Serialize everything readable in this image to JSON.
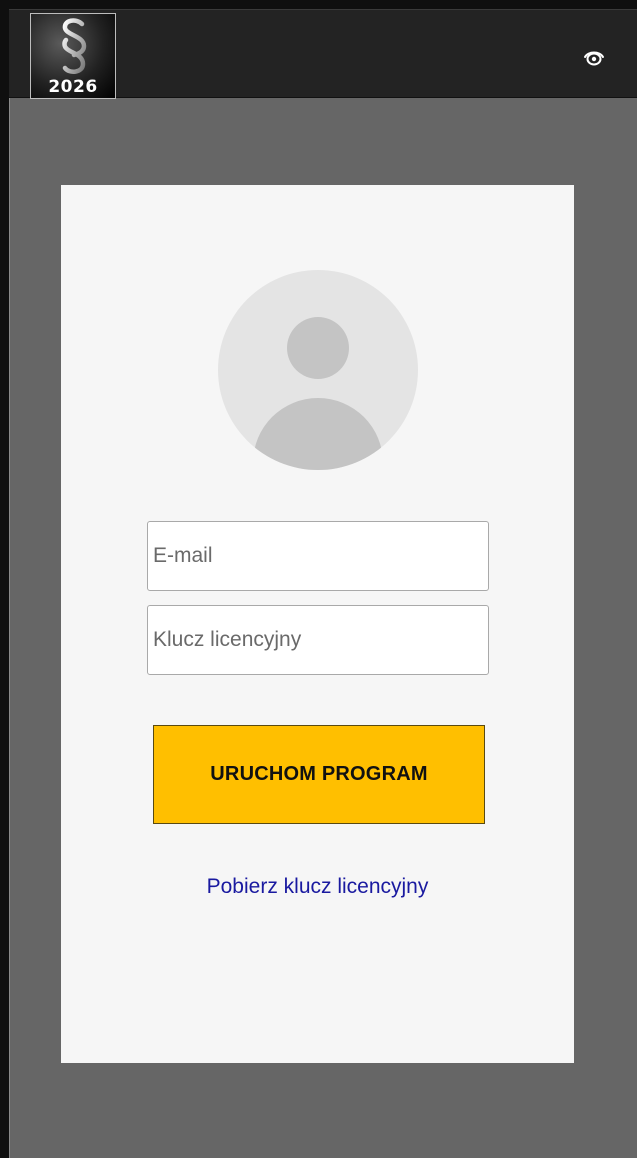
{
  "header": {
    "logo_year": "2026",
    "logo_symbol": "§",
    "eye_icon": "eye-icon"
  },
  "login": {
    "avatar_icon": "user-avatar-icon",
    "email_placeholder": "E-mail",
    "email_value": "",
    "license_placeholder": "Klucz licencyjny",
    "license_value": "",
    "launch_label": "URUCHOM PROGRAM",
    "get_license_link": "Pobierz klucz licencyjny"
  },
  "colors": {
    "background": "#666666",
    "titlebar": "#232323",
    "card": "#f6f6f6",
    "button": "#ffbf00",
    "link": "#1a1aa0"
  }
}
